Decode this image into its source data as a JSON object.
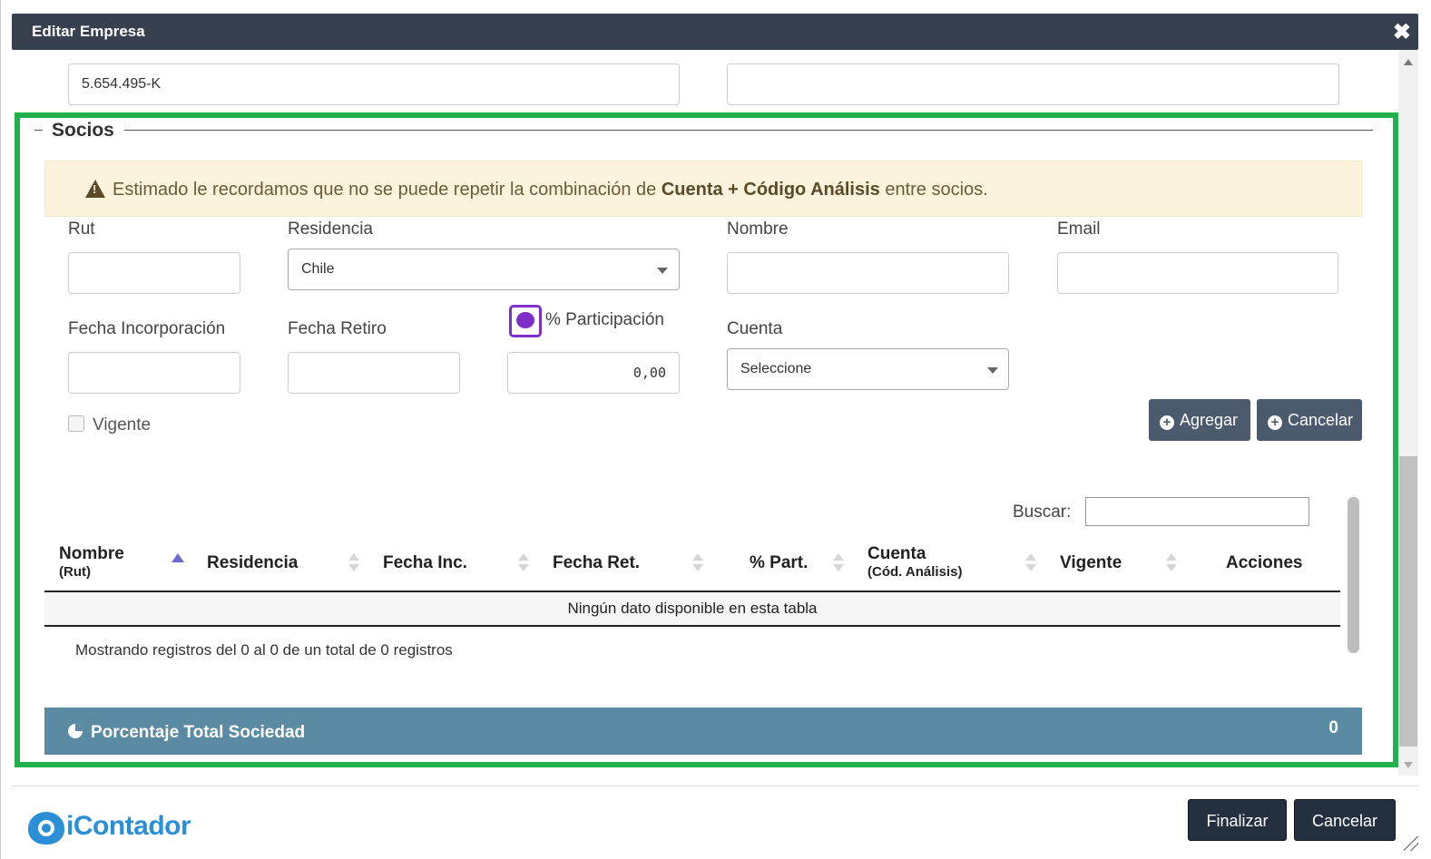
{
  "dialog": {
    "title": "Editar Empresa",
    "close_glyph": "✖"
  },
  "top_fields": {
    "rut_value": "5.654.495-K",
    "second_value": ""
  },
  "socios": {
    "legend": "Socios",
    "alert": {
      "prefix": "Estimado le recordamos que no se puede repetir la combinación de",
      "bold": "Cuenta + Código Análisis",
      "suffix": "entre socios."
    },
    "labels": {
      "rut": "Rut",
      "residencia": "Residencia",
      "nombre": "Nombre",
      "email": "Email",
      "fecha_incorporacion": "Fecha Incorporación",
      "fecha_retiro": "Fecha Retiro",
      "participacion": "% Participación",
      "cuenta": "Cuenta",
      "vigente": "Vigente"
    },
    "values": {
      "residencia": "Chile",
      "participacion": "0,00",
      "cuenta": "Seleccione"
    },
    "buttons": {
      "agregar": "Agregar",
      "cancelar": "Cancelar"
    }
  },
  "table": {
    "search_label": "Buscar:",
    "columns": [
      {
        "label": "Nombre",
        "sub": "(Rut)"
      },
      {
        "label": "Residencia",
        "sub": ""
      },
      {
        "label": "Fecha Inc.",
        "sub": ""
      },
      {
        "label": "Fecha Ret.",
        "sub": ""
      },
      {
        "label": "% Part.",
        "sub": ""
      },
      {
        "label": "Cuenta",
        "sub": "(Cód. Análisis)"
      },
      {
        "label": "Vigente",
        "sub": ""
      },
      {
        "label": "Acciones",
        "sub": ""
      }
    ],
    "empty_message": "Ningún dato disponible en esta tabla",
    "info": "Mostrando registros del 0 al 0 de un total de 0 registros"
  },
  "total_bar": {
    "label": "Porcentaje Total Sociedad",
    "value": "0"
  },
  "footer": {
    "logo_text": "iContador",
    "finalizar": "Finalizar",
    "cancelar": "Cancelar"
  },
  "colors": {
    "titlebar": "#36404e",
    "highlight": "#22b14c",
    "bar": "#5a8ba3",
    "button": "#4b5a6d",
    "logo": "#2a8fd6"
  }
}
